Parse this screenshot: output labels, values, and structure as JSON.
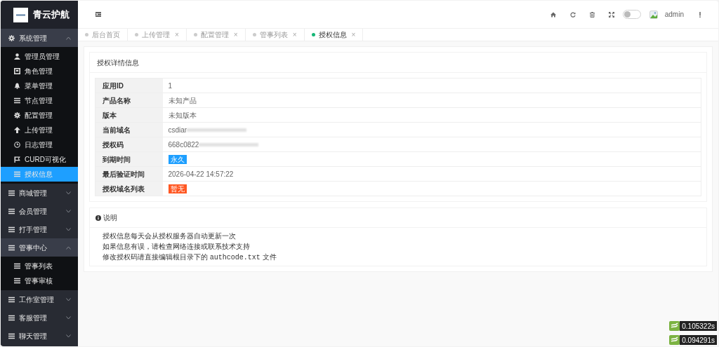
{
  "sidebar": {
    "logo_text": "青云护航",
    "groups": [
      {
        "label": "系统管理",
        "expanded": true,
        "children": [
          {
            "label": "管理员管理",
            "selected": false
          },
          {
            "label": "角色管理",
            "selected": false
          },
          {
            "label": "菜单管理",
            "selected": false
          },
          {
            "label": "节点管理",
            "selected": false
          },
          {
            "label": "配置管理",
            "selected": false
          },
          {
            "label": "上传管理",
            "selected": false
          },
          {
            "label": "日志管理",
            "selected": false
          },
          {
            "label": "CURD可视化",
            "selected": false
          },
          {
            "label": "授权信息",
            "selected": true
          }
        ]
      },
      {
        "label": "商城管理",
        "expanded": false
      },
      {
        "label": "会员管理",
        "expanded": false
      },
      {
        "label": "打手管理",
        "expanded": false
      },
      {
        "label": "管事中心",
        "expanded": true,
        "children": [
          {
            "label": "管事列表",
            "selected": false
          },
          {
            "label": "管事审核",
            "selected": false
          }
        ]
      },
      {
        "label": "工作室管理",
        "expanded": false
      },
      {
        "label": "客服管理",
        "expanded": false
      },
      {
        "label": "聊天管理",
        "expanded": false
      }
    ]
  },
  "header": {
    "theme_switch_on": false,
    "username": "admin"
  },
  "tabs": [
    {
      "label": "后台首页",
      "selected": false
    },
    {
      "label": "上传管理",
      "close_mark": "×",
      "selected": false
    },
    {
      "label": "配置管理",
      "close_mark": "×",
      "selected": false
    },
    {
      "label": "管事列表",
      "close_mark": "×",
      "selected": false
    },
    {
      "label": "授权信息",
      "close_mark": "×",
      "selected": true
    }
  ],
  "details": {
    "title": "授权详情信息",
    "rows": [
      {
        "label": "应用ID",
        "kind": "text",
        "value": "1"
      },
      {
        "label": "产品名称",
        "kind": "text",
        "value": "未知产品"
      },
      {
        "label": "版本",
        "kind": "text",
        "value": "未知版本"
      },
      {
        "label": "当前域名",
        "kind": "blurred",
        "value": "csdiar"
      },
      {
        "label": "授权码",
        "kind": "blurred",
        "value": "668c0822"
      },
      {
        "label": "到期时间",
        "kind": "tag",
        "value": "永久",
        "color": "#1e9fff"
      },
      {
        "label": "最后验证时间",
        "kind": "text",
        "value": "2026-04-22 14:57:22"
      },
      {
        "label": "授权域名列表",
        "kind": "tag",
        "value": "暂无",
        "color": "#ff5722"
      }
    ]
  },
  "notes": {
    "title": "说明",
    "lines": [
      "授权信息每天会从授权服务器自动更新一次",
      "如果信息有误，请检查网络连接或联系技术支持"
    ],
    "last_line": {
      "before": "修改授权码请直接编辑根目录下的",
      "code": "authcode.txt",
      "after": "文件"
    }
  },
  "debug_timers": [
    "0.105322s",
    "0.094291s"
  ]
}
